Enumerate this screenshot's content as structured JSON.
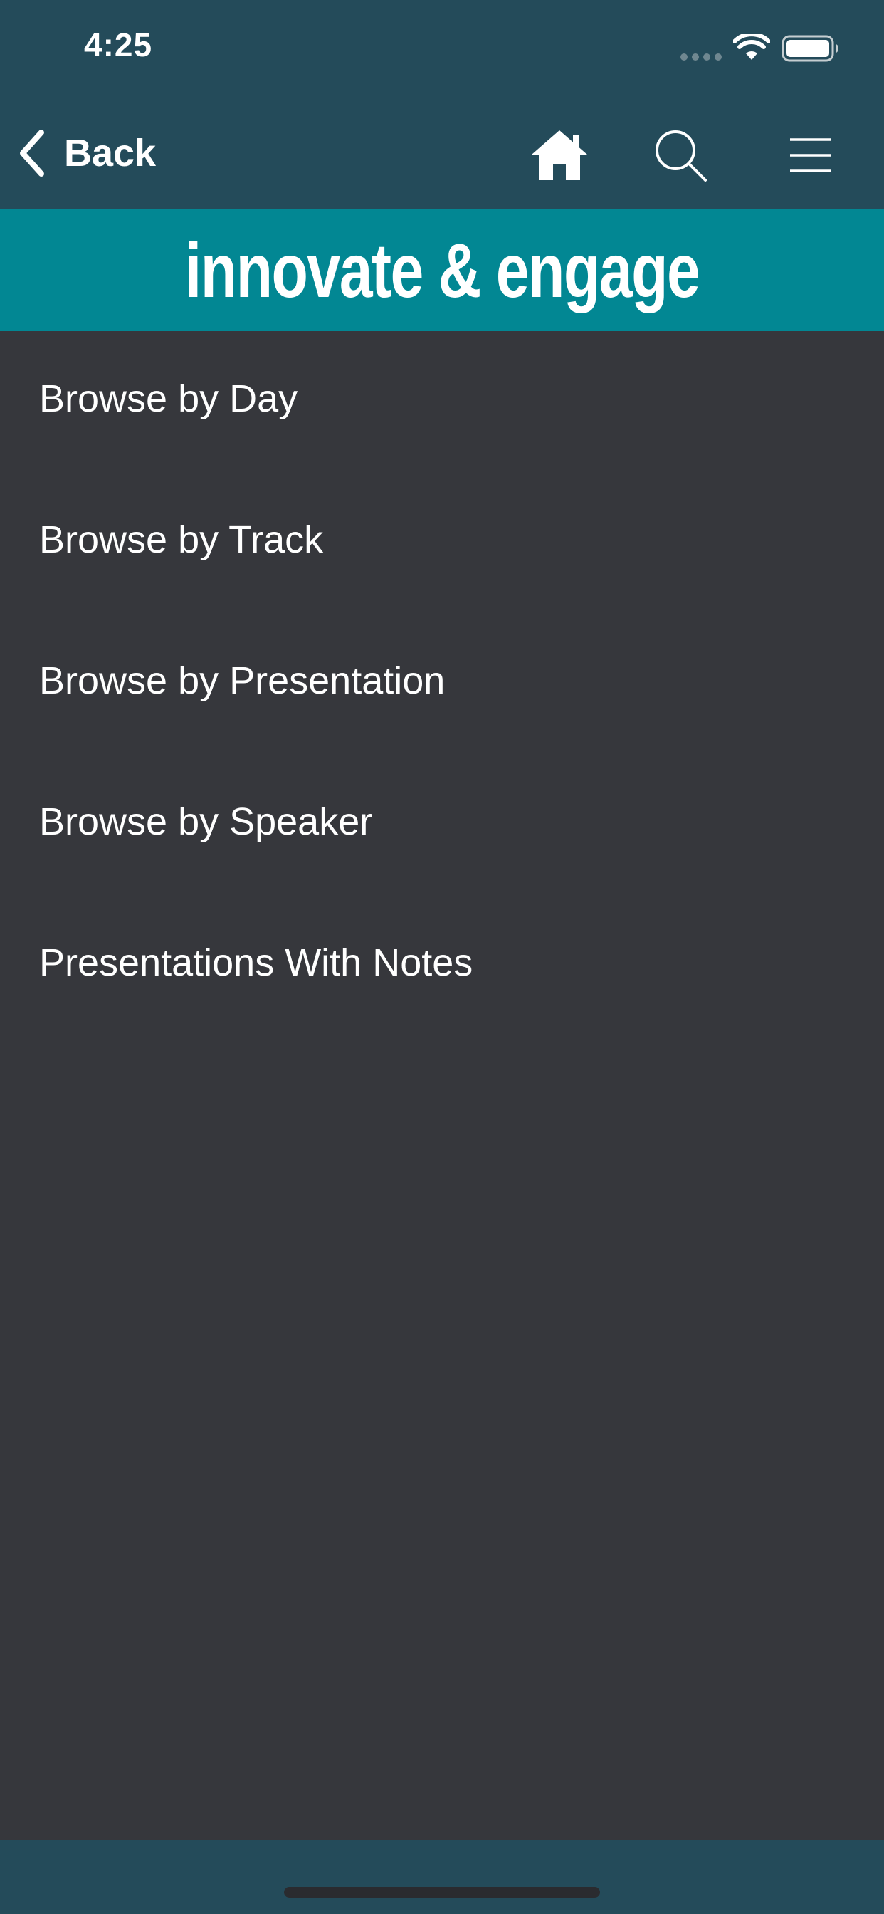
{
  "status_bar": {
    "time": "4:25"
  },
  "nav": {
    "back_label": "Back"
  },
  "banner": {
    "title": "innovate & engage"
  },
  "browse_items": [
    {
      "label": "Browse by Day"
    },
    {
      "label": "Browse by Track"
    },
    {
      "label": "Browse by Presentation"
    },
    {
      "label": "Browse by Speaker"
    },
    {
      "label": "Presentations With Notes"
    }
  ],
  "colors": {
    "header": "#244b5a",
    "banner": "#028793",
    "background": "#36373c",
    "text": "#ffffff"
  },
  "icons": [
    "chevron-left-icon",
    "home-icon",
    "search-icon",
    "menu-icon",
    "wifi-icon",
    "battery-icon",
    "signal-icon"
  ]
}
